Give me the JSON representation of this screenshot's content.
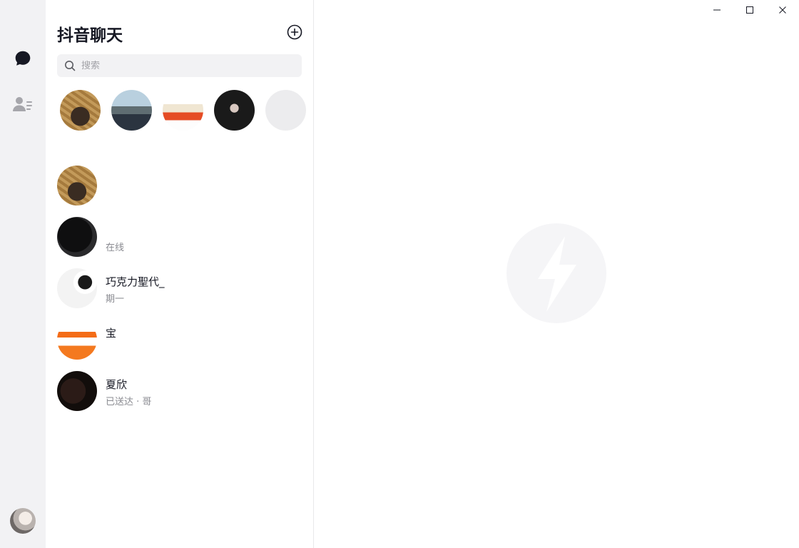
{
  "app": {
    "title": "抖音聊天"
  },
  "rail": {
    "items": [
      {
        "icon": "chat-bubble-icon",
        "active": true
      },
      {
        "icon": "contacts-icon",
        "active": false
      }
    ]
  },
  "search": {
    "placeholder": "搜索",
    "value": ""
  },
  "stories": [
    {
      "name": ""
    },
    {
      "name": ""
    },
    {
      "name": ""
    },
    {
      "name": ""
    },
    {
      "name": ""
    }
  ],
  "conversations": [
    {
      "name": "",
      "subtitle": ""
    },
    {
      "name": "",
      "subtitle": "在线"
    },
    {
      "name": "巧克力聖代_",
      "subtitle": "期一"
    },
    {
      "name": "宝",
      "subtitle": ""
    },
    {
      "name": "夏欣",
      "subtitle": "已送达 · 哥"
    }
  ],
  "colors": {
    "rail_bg": "#f2f2f4",
    "text": "#161823",
    "muted": "#8a8b91",
    "search_bg": "#f2f2f4",
    "watermark": "#f5f5f7"
  }
}
